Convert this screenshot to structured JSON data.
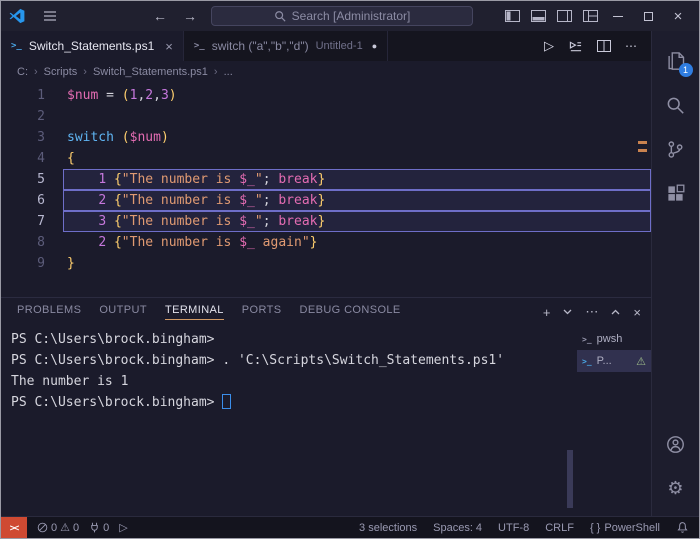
{
  "colors": {
    "accent_blue": "#3b8eea",
    "keyword_blue": "#5fb4f2",
    "variable_pink": "#e36cb2",
    "string_orange": "#e09a72",
    "number_purple": "#c678dd",
    "brace_gold": "#ffcf6e",
    "selection_border": "#6e6ec8",
    "remote_orange": "#cf4a32",
    "badge_blue": "#2f7de1",
    "minimap_mark_orange": "#c9824f"
  },
  "icons": {
    "back": "←",
    "forward": "→",
    "dot": "●",
    "close": "×",
    "ellipsis": "⋯",
    "plus": "+",
    "play": "▷",
    "gear": "⚙",
    "warning": "⚠",
    "terminal_prompt": ">_",
    "breadcrumb_separator": "›",
    "braces": "{ }",
    "remote": "><"
  },
  "titlebar": {
    "search_placeholder": "Search [Administrator]"
  },
  "tabs": [
    {
      "label": "Switch_Statements.ps1"
    },
    {
      "label": "switch (\"a\",\"b\",\"d\")",
      "secondary": "Untitled-1"
    }
  ],
  "breadcrumb": [
    "C:",
    "Scripts",
    "Switch_Statements.ps1",
    "..."
  ],
  "editor": {
    "lines": [
      {
        "num": 1,
        "tokens": [
          {
            "t": "$num",
            "c": "var"
          },
          {
            "t": " = ",
            "c": "op"
          },
          {
            "t": "(",
            "c": "paren"
          },
          {
            "t": "1",
            "c": "num"
          },
          {
            "t": ",",
            "c": "op"
          },
          {
            "t": "2",
            "c": "num"
          },
          {
            "t": ",",
            "c": "op"
          },
          {
            "t": "3",
            "c": "num"
          },
          {
            "t": ")",
            "c": "paren"
          }
        ]
      },
      {
        "num": 2,
        "tokens": []
      },
      {
        "num": 3,
        "tokens": [
          {
            "t": "switch ",
            "c": "kw"
          },
          {
            "t": "(",
            "c": "paren"
          },
          {
            "t": "$num",
            "c": "var"
          },
          {
            "t": ")",
            "c": "paren"
          }
        ]
      },
      {
        "num": 4,
        "tokens": [
          {
            "t": "{",
            "c": "paren"
          }
        ]
      },
      {
        "num": 5,
        "selected": true,
        "tokens": [
          {
            "t": "    ",
            "c": "op"
          },
          {
            "t": "1",
            "c": "num"
          },
          {
            "t": " ",
            "c": "op"
          },
          {
            "t": "{",
            "c": "paren"
          },
          {
            "t": "\"The number is ",
            "c": "str"
          },
          {
            "t": "$_",
            "c": "var"
          },
          {
            "t": "\"",
            "c": "str"
          },
          {
            "t": "; ",
            "c": "op"
          },
          {
            "t": "break",
            "c": "kw2"
          },
          {
            "t": "}",
            "c": "paren"
          }
        ]
      },
      {
        "num": 6,
        "selected": true,
        "tokens": [
          {
            "t": "    ",
            "c": "op"
          },
          {
            "t": "2",
            "c": "num"
          },
          {
            "t": " ",
            "c": "op"
          },
          {
            "t": "{",
            "c": "paren"
          },
          {
            "t": "\"The number is ",
            "c": "str"
          },
          {
            "t": "$_",
            "c": "var"
          },
          {
            "t": "\"",
            "c": "str"
          },
          {
            "t": "; ",
            "c": "op"
          },
          {
            "t": "break",
            "c": "kw2"
          },
          {
            "t": "}",
            "c": "paren"
          }
        ]
      },
      {
        "num": 7,
        "selected": true,
        "tokens": [
          {
            "t": "    ",
            "c": "op"
          },
          {
            "t": "3",
            "c": "num"
          },
          {
            "t": " ",
            "c": "op"
          },
          {
            "t": "{",
            "c": "paren"
          },
          {
            "t": "\"The number is ",
            "c": "str"
          },
          {
            "t": "$_",
            "c": "var"
          },
          {
            "t": "\"",
            "c": "str"
          },
          {
            "t": "; ",
            "c": "op"
          },
          {
            "t": "break",
            "c": "kw2"
          },
          {
            "t": "}",
            "c": "paren"
          }
        ]
      },
      {
        "num": 8,
        "tokens": [
          {
            "t": "    ",
            "c": "op"
          },
          {
            "t": "2",
            "c": "num"
          },
          {
            "t": " ",
            "c": "op"
          },
          {
            "t": "{",
            "c": "paren"
          },
          {
            "t": "\"The number is ",
            "c": "str"
          },
          {
            "t": "$_",
            "c": "var"
          },
          {
            "t": " again\"",
            "c": "str"
          },
          {
            "t": "}",
            "c": "paren"
          }
        ]
      },
      {
        "num": 9,
        "tokens": [
          {
            "t": "}",
            "c": "paren"
          }
        ]
      }
    ]
  },
  "panel": {
    "tabs": [
      {
        "label": "PROBLEMS"
      },
      {
        "label": "OUTPUT"
      },
      {
        "label": "TERMINAL",
        "active": true
      },
      {
        "label": "PORTS"
      },
      {
        "label": "DEBUG CONSOLE"
      }
    ]
  },
  "terminal": {
    "lines": [
      {
        "text": "PS C:\\Users\\brock.bingham>"
      },
      {
        "text": "PS C:\\Users\\brock.bingham> . 'C:\\Scripts\\Switch_Statements.ps1'"
      },
      {
        "text": "The number is 1"
      },
      {
        "text": "PS C:\\Users\\brock.bingham> ",
        "cursor": true
      }
    ],
    "list": [
      {
        "label": "pwsh"
      },
      {
        "label": "P...",
        "selected": true,
        "warning": true
      }
    ]
  },
  "activitybar": {
    "explorer_badge": "1"
  },
  "status": {
    "errors": "0",
    "warnings": "0",
    "ports": "0",
    "selections": "3 selections",
    "indent": "Spaces: 4",
    "encoding": "UTF-8",
    "eol": "CRLF",
    "language": "PowerShell"
  }
}
